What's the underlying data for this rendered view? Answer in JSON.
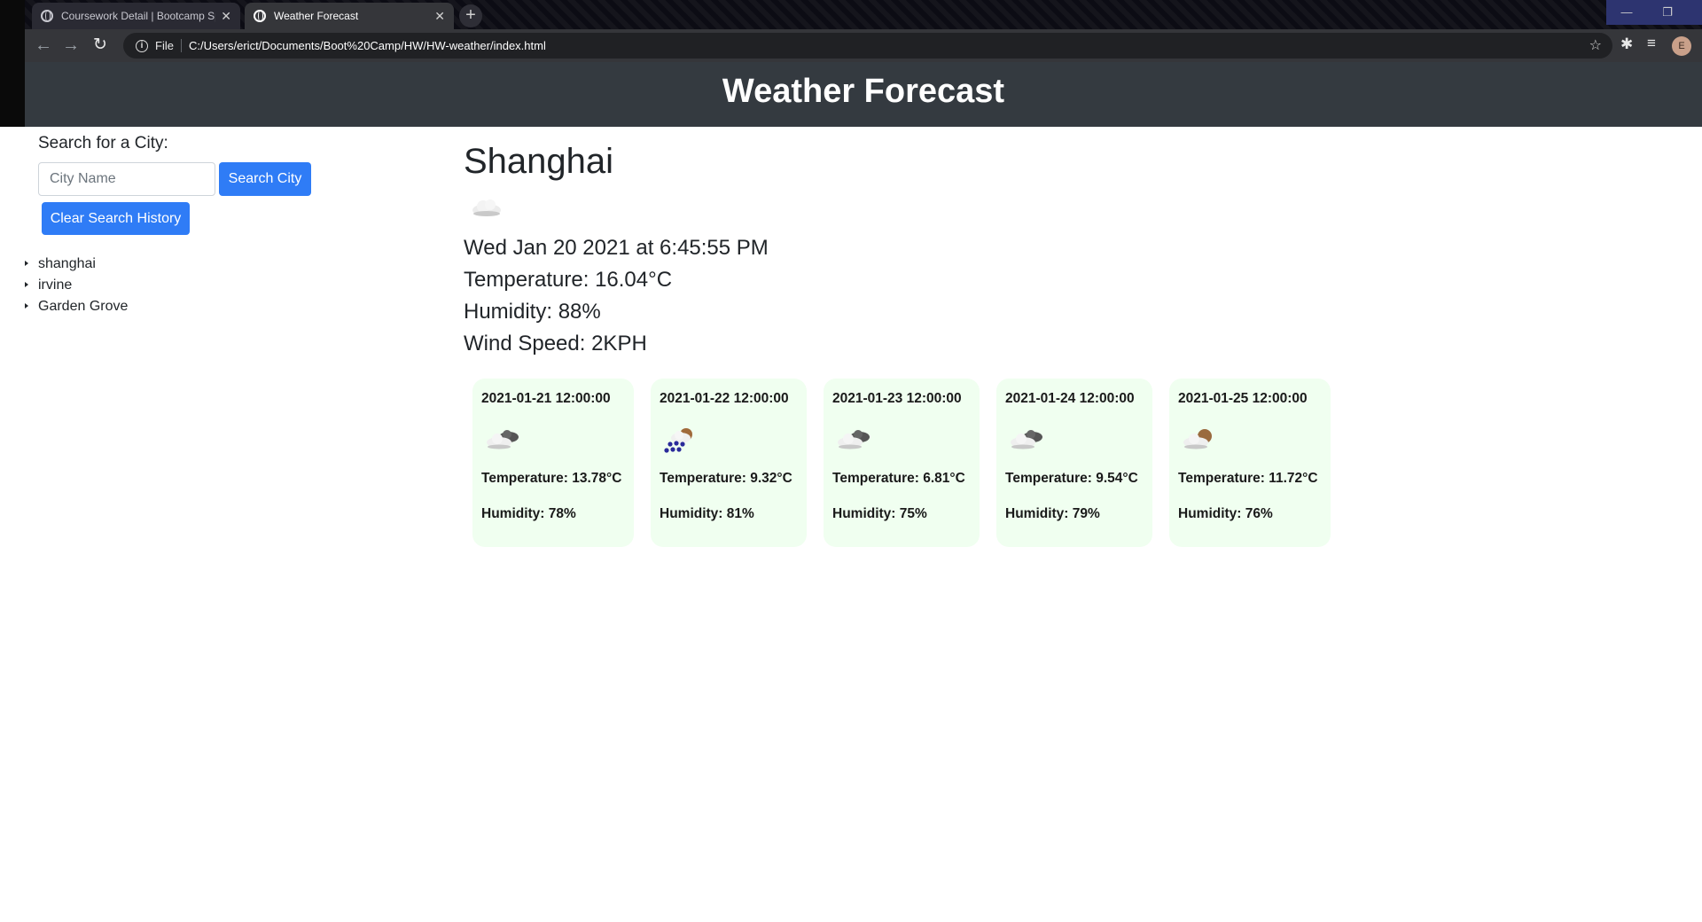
{
  "browser": {
    "tabs": [
      {
        "title": "Coursework Detail | Bootcamp Sp",
        "active": false
      },
      {
        "title": "Weather Forecast",
        "active": true
      }
    ],
    "scheme": "File",
    "url": "C:/Users/erict/Documents/Boot%20Camp/HW/HW-weather/index.html",
    "profile_initial": "E"
  },
  "header": {
    "title": "Weather Forecast"
  },
  "search": {
    "label": "Search for a City:",
    "placeholder": "City Name",
    "button_label": "Search City",
    "clear_label": "Clear Search History"
  },
  "history": [
    "shanghai",
    "irvine",
    "Garden Grove"
  ],
  "current": {
    "city": "Shanghai",
    "icon": "cloud-icon",
    "date": "Wed Jan 20 2021 at 6:45:55 PM",
    "temperature": "Temperature: 16.04°C",
    "humidity": "Humidity: 88%",
    "wind": "Wind Speed: 2KPH"
  },
  "forecast": [
    {
      "date": "2021-01-21 12:00:00",
      "icon": "broken-clouds-icon",
      "temperature": "Temperature: 13.78°C",
      "humidity": "Humidity: 78%"
    },
    {
      "date": "2021-01-22 12:00:00",
      "icon": "rain-icon",
      "temperature": "Temperature: 9.32°C",
      "humidity": "Humidity: 81%"
    },
    {
      "date": "2021-01-23 12:00:00",
      "icon": "broken-clouds-icon",
      "temperature": "Temperature: 6.81°C",
      "humidity": "Humidity: 75%"
    },
    {
      "date": "2021-01-24 12:00:00",
      "icon": "broken-clouds-icon",
      "temperature": "Temperature: 9.54°C",
      "humidity": "Humidity: 79%"
    },
    {
      "date": "2021-01-25 12:00:00",
      "icon": "few-clouds-icon",
      "temperature": "Temperature: 11.72°C",
      "humidity": "Humidity: 76%"
    }
  ],
  "colors": {
    "header_bg": "#343a40",
    "button_bg": "#2f7cf6",
    "card_bg": "#f0fff0"
  }
}
